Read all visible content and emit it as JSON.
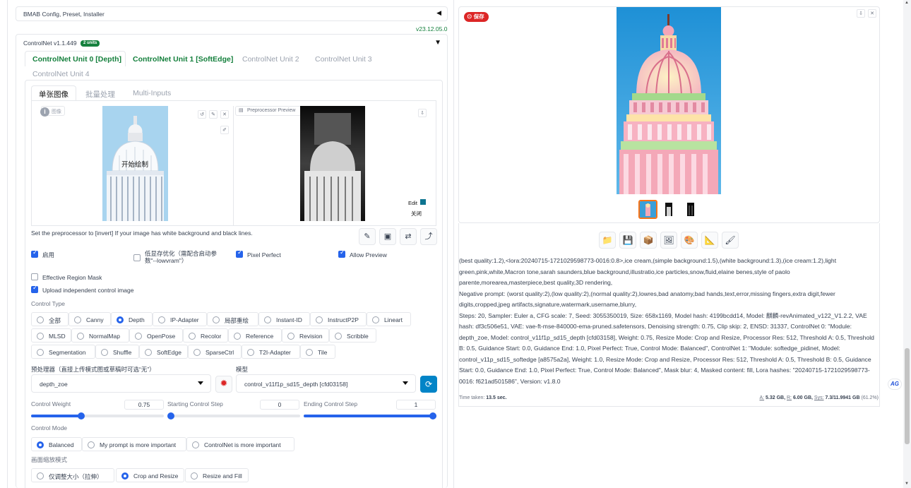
{
  "bmab": {
    "title": "BMAB Config, Preset, Installer",
    "version": "v23.12.05.0"
  },
  "controlnet": {
    "title": "ControlNet v1.1.449",
    "badge": "2 units",
    "unit_tabs": [
      "ControlNet Unit 0 [Depth]",
      "ControlNet Unit 1 [SoftEdge]",
      "ControlNet Unit 2",
      "ControlNet Unit 3",
      "ControlNet Unit 4"
    ],
    "sub_tabs": [
      "单张图像",
      "批量处理",
      "Multi-Inputs"
    ],
    "image_panel": {
      "overlay_text": "开始绘制",
      "badge": "图像"
    },
    "preview_panel": {
      "label": "Preprocessor Preview",
      "edit": "Edit",
      "close": "关闭"
    },
    "invert_hint": "Set the preprocessor to [invert] If your image has white background and black lines.",
    "checks": {
      "enable": "启用",
      "lowvram": "低显存优化（需配合启动参数\"--lowvram\"）",
      "pixel_perfect": "Pixel Perfect",
      "allow_preview": "Allow Preview",
      "effective_region": "Effective Region Mask",
      "upload_independent": "Upload independent control image"
    },
    "control_type_label": "Control Type",
    "control_types": [
      [
        "全部",
        "Canny",
        "Depth",
        "IP-Adapter",
        "局部重绘",
        "Instant-ID",
        "InstructP2P",
        "Lineart"
      ],
      [
        "MLSD",
        "NormalMap",
        "OpenPose",
        "Recolor",
        "Reference",
        "Revision",
        "Scribble"
      ],
      [
        "Segmentation",
        "Shuffle",
        "SoftEdge",
        "SparseCtrl",
        "T2I-Adapter",
        "Tile"
      ]
    ],
    "control_type_selected": "Depth",
    "preprocessor_label": "预处理器（直接上传模式图或草稿时可选“无”）",
    "preprocessor_value": "depth_zoe",
    "model_label": "模型",
    "model_value": "control_v11f1p_sd15_depth [cfd03158]",
    "control_weight": {
      "label": "Control Weight",
      "value": "0.75",
      "fraction": 0.37
    },
    "starting_step": {
      "label": "Starting Control Step",
      "value": "0",
      "fraction": 0.0
    },
    "ending_step": {
      "label": "Ending Control Step",
      "value": "1",
      "fraction": 1.0
    },
    "control_mode_label": "Control Mode",
    "control_modes": [
      "Balanced",
      "My prompt is more important",
      "ControlNet is more important"
    ],
    "resize_label": "画面缩放模式",
    "resize_modes": [
      "仅调整大小（拉伸）",
      "Crop and Resize",
      "Resize and Fill"
    ]
  },
  "output": {
    "save_badge": "保存",
    "info_paragraphs": [
      "(best quality:1.2),<lora:20240715-1721029598773-0016:0.8>,ice cream,(simple background:1.5),(white background:1.3),(ice cream:1.2),light green,pink,white,Macron tone,sarah saunders,blue background,illustratio,ice particles,snow,fluid,elaine benes,style of paolo parente,morearea,masterpiece,best quality,3D rendering,",
      "Negative prompt: (worst quality:2),(low quality:2),(normal quality:2),lowres,bad anatomy,bad hands,text,error,missing fingers,extra digit,fewer digits,cropped,jpeg artifacts,signature,watermark,username,blurry,",
      "Steps: 20, Sampler: Euler a, CFG scale: 7, Seed: 3055350019, Size: 658x1169, Model hash: 4199bcdd14, Model: 麒麟-revAnimated_v122_V1.2.2, VAE hash: df3c506e51, VAE: vae-ft-mse-840000-ema-pruned.safetensors, Denoising strength: 0.75, Clip skip: 2, ENSD: 31337, ControlNet 0: \"Module: depth_zoe, Model: control_v11f1p_sd15_depth [cfd03158], Weight: 0.75, Resize Mode: Crop and Resize, Processor Res: 512, Threshold A: 0.5, Threshold B: 0.5, Guidance Start: 0.0, Guidance End: 1.0, Pixel Perfect: True, Control Mode: Balanced\", ControlNet 1: \"Module: softedge_pidinet, Model: control_v11p_sd15_softedge [a8575a2a], Weight: 1.0, Resize Mode: Crop and Resize, Processor Res: 512, Threshold A: 0.5, Threshold B: 0.5, Guidance Start: 0.0, Guidance End: 1.0, Pixel Perfect: True, Control Mode: Balanced\", Mask blur: 4, Masked content: fill, Lora hashes: \"20240715-1721029598773-0016: f621ad501586\", Version: v1.8.0"
    ],
    "time_label": "Time taken:",
    "time_value": "13.5 sec.",
    "mem_a_label": "A:",
    "mem_a": "5.32 GB,",
    "mem_r_label": "R:",
    "mem_r": "6.00 GB,",
    "mem_sys_label": "Sys:",
    "mem_sys": "7.3/11.9941 GB",
    "mem_pct": "(61.2%)",
    "side_badge": "AG"
  },
  "colors": {
    "accent": "#2563eb",
    "green": "#15803d",
    "badge_green": "#15803d",
    "sky": "#3b9fd8"
  }
}
